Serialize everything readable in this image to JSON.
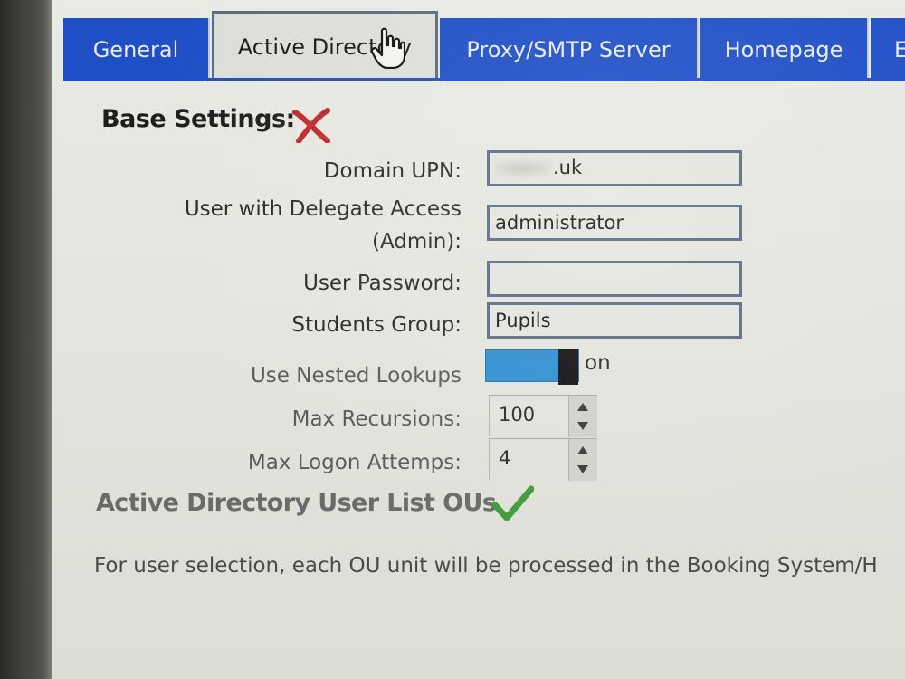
{
  "tabs": [
    {
      "label": "General",
      "active": false
    },
    {
      "label": "Active Directory",
      "active": true
    },
    {
      "label": "Proxy/SMTP Server",
      "active": false
    },
    {
      "label": "Homepage",
      "active": false
    },
    {
      "label": "E",
      "active": false
    }
  ],
  "base_settings": {
    "title": "Base Settings:",
    "status_icon": "red-x-icon",
    "domain_upn": {
      "label": "Domain UPN:",
      "value": ".uk"
    },
    "delegate_user": {
      "label_line1": "User with Delegate Access",
      "label_line2": "(Admin):",
      "value": "administrator"
    },
    "user_password": {
      "label": "User Password:",
      "value": ""
    },
    "students_group": {
      "label": "Students Group:",
      "value": "Pupils"
    },
    "nested_lookups": {
      "label": "Use Nested Lookups",
      "state": "on"
    },
    "max_recursions": {
      "label": "Max Recursions:",
      "value": "100"
    },
    "max_logon_attempts": {
      "label": "Max Logon Attemps:",
      "value": "4"
    }
  },
  "ou_section": {
    "title": "Active Directory User List OUs",
    "status_icon": "green-check-icon",
    "description": "For user selection, each OU unit will be processed in the Booking System/H"
  },
  "colors": {
    "tab_blue": "#1f4fc7",
    "toggle_blue": "#2f8fd0",
    "error_red": "#c0282a",
    "ok_green": "#3f9a3a"
  }
}
